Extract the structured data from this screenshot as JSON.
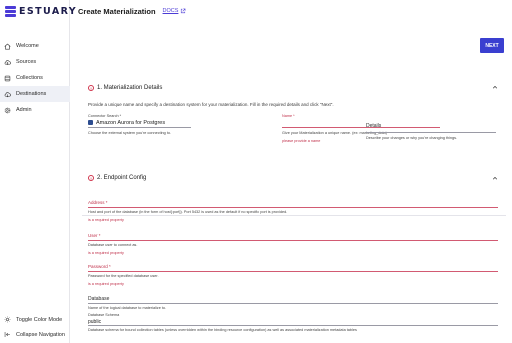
{
  "brand": {
    "name": "ESTUARY",
    "accent": "#4b3bd6"
  },
  "sidebar": {
    "items": [
      {
        "label": "Welcome",
        "icon": "home-icon"
      },
      {
        "label": "Sources",
        "icon": "cloud-upload-icon"
      },
      {
        "label": "Collections",
        "icon": "database-icon"
      },
      {
        "label": "Destinations",
        "icon": "cloud-download-icon",
        "active": true
      },
      {
        "label": "Admin",
        "icon": "gear-icon"
      }
    ],
    "bottom": [
      {
        "label": "Toggle Color Mode",
        "icon": "sun-icon"
      },
      {
        "label": "Collapse Navigation",
        "icon": "collapse-icon"
      }
    ]
  },
  "header": {
    "title": "Create Materialization",
    "docs_label": "DOCS"
  },
  "toolbar": {
    "next_label": "NEXT"
  },
  "materialization_details": {
    "title": "1. Materialization Details",
    "intro": "Provide a unique name and specify a destination system for your materialization. Fill in the required details and click \"Next\".",
    "connector": {
      "label": "Connector Search *",
      "value": "Amazon Aurora for Postgres",
      "help": "Choose the external system you're connecting to."
    },
    "name": {
      "label": "Name *",
      "help": "Give your Materialization a unique name. (ex: marketing_data)",
      "error": "please provide a name"
    },
    "details": {
      "label": "Details",
      "help": "Describe your changes or why you're changing things."
    }
  },
  "endpoint_config": {
    "title": "2. Endpoint Config",
    "address": {
      "label": "Address *",
      "help": "Host and port of the database (in the form of host[:port]). Port 5432 is used as the default if no specific port is provided.",
      "error": "is a required property"
    },
    "user": {
      "label": "User *",
      "help": "Database user to connect as.",
      "error": "is a required property"
    },
    "password": {
      "label": "Password *",
      "help": "Password for the specified database user.",
      "error": "is a required property"
    },
    "database": {
      "label": "Database",
      "help": "Name of the logical database to materialize to."
    },
    "schema": {
      "label": "Database Schema",
      "value": "public",
      "help": "Database schema for bound collection tables (unless overridden within the binding resource configuration) as well as associated materialization metadata tables"
    }
  }
}
